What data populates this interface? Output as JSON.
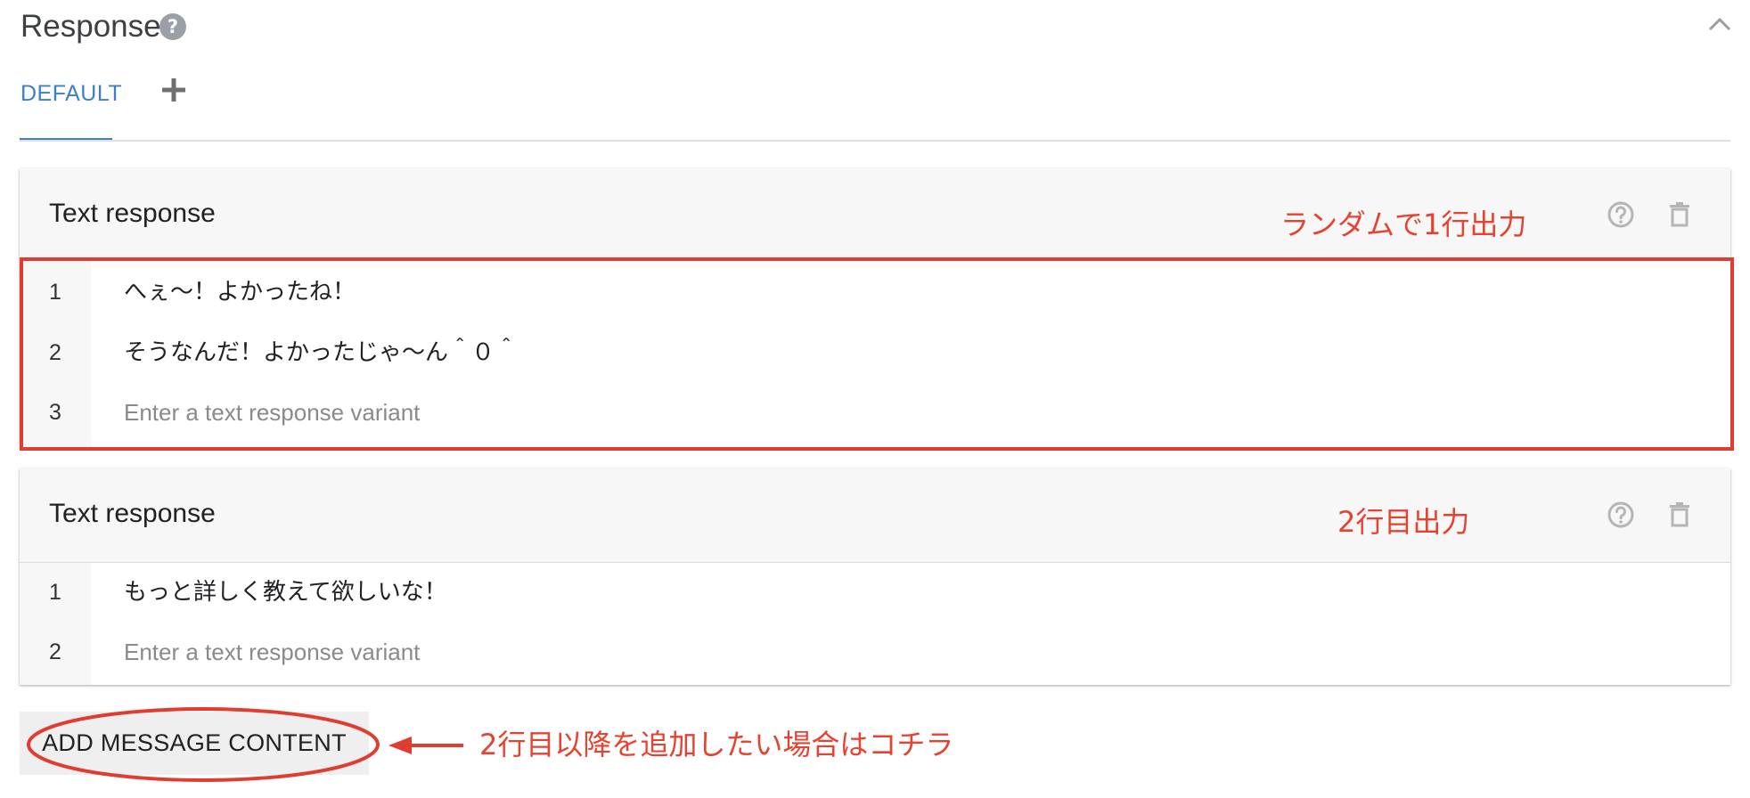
{
  "header": {
    "title": "Response",
    "help_icon": "help-circle-icon",
    "collapse_icon": "chevron-up-icon"
  },
  "tabs": {
    "items": [
      {
        "label": "DEFAULT",
        "active": true
      }
    ],
    "add_icon": "plus-icon"
  },
  "cards": [
    {
      "title": "Text response",
      "help_icon": "help-outline-icon",
      "delete_icon": "trash-icon",
      "rows": [
        {
          "num": "1",
          "text": "へぇ〜！よかったね！"
        },
        {
          "num": "2",
          "text": "そうなんだ！よかったじゃ〜ん＾０＾"
        },
        {
          "num": "3",
          "placeholder": "Enter a text response variant"
        }
      ]
    },
    {
      "title": "Text response",
      "help_icon": "help-outline-icon",
      "delete_icon": "trash-icon",
      "rows": [
        {
          "num": "1",
          "text": "もっと詳しく教えて欲しいな！"
        },
        {
          "num": "2",
          "placeholder": "Enter a text response variant"
        }
      ]
    }
  ],
  "add_button": {
    "label": "ADD MESSAGE CONTENT"
  },
  "annotations": {
    "random_line": "ランダムで1行出力",
    "second_line": "2行目出力",
    "add_hint": "2行目以降を追加したい場合はコチラ"
  },
  "colors": {
    "accent": "#3b7fd0",
    "annotation": "#e8412f",
    "card_header": "#f7f7f7",
    "icon_gray": "#9aa0a6"
  }
}
